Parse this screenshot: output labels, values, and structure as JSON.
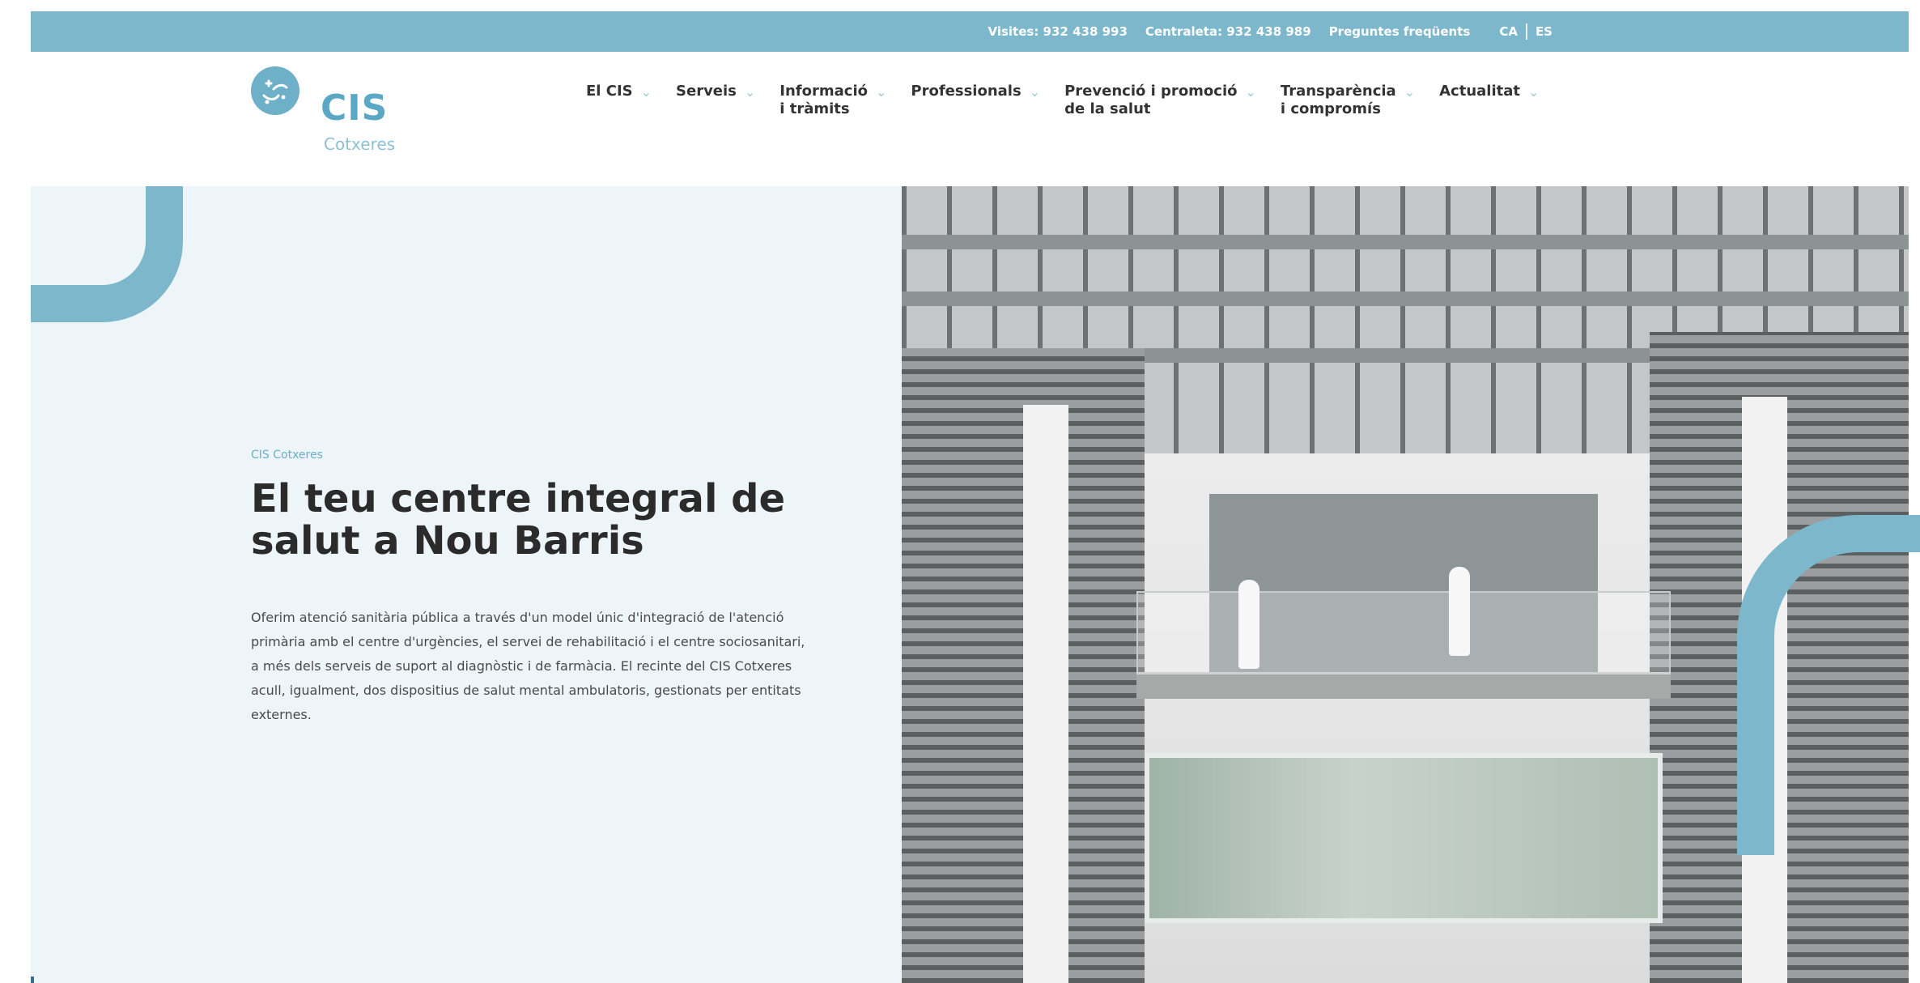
{
  "topbar": {
    "visits": "Visites: 932 438 993",
    "switchboard": "Centraleta: 932 438 989",
    "faq": "Preguntes freqüents",
    "lang_ca": "CA",
    "lang_es": "ES"
  },
  "logo": {
    "name": "CIS",
    "subtitle": "Cotxeres",
    "icon": "logo-mark-icon"
  },
  "nav": {
    "items": [
      {
        "line1": "El CIS",
        "line2": ""
      },
      {
        "line1": "Serveis",
        "line2": ""
      },
      {
        "line1": "Informació",
        "line2": "i tràmits"
      },
      {
        "line1": "Professionals",
        "line2": ""
      },
      {
        "line1": "Prevenció i promoció",
        "line2": "de la salut"
      },
      {
        "line1": "Transparència",
        "line2": "i compromís"
      },
      {
        "line1": "Actualitat",
        "line2": ""
      }
    ],
    "chevron": "chevron-down-icon"
  },
  "hero": {
    "kicker": "CIS Cotxeres",
    "title": "El teu centre integral de salut a Nou Barris",
    "description": "Oferim atenció sanitària pública a través d'un model únic d'integració de l'atenció primària amb el centre d'urgències, el servei de rehabilitació i el centre sociosanitari, a més dels serveis de suport al diagnòstic i de farmàcia. El recinte del CIS Cotxeres acull, igualment, dos dispositius de salut mental ambulatoris, gestionats per entitats externes."
  },
  "colors": {
    "brand": "#7cb7cc",
    "hero_bg": "#eef5f9",
    "text_dark": "#2b2b2b"
  }
}
